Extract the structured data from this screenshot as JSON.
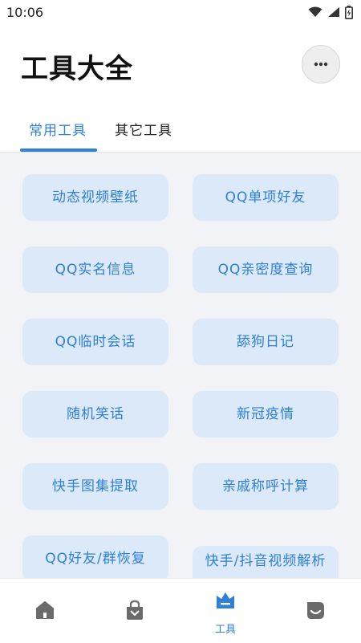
{
  "status_bar": {
    "time": "10:06"
  },
  "header": {
    "title": "工具大全"
  },
  "tabs": [
    {
      "label": "常用工具",
      "active": true
    },
    {
      "label": "其它工具",
      "active": false
    }
  ],
  "tools": [
    "动态视频壁纸",
    "QQ单项好友",
    "QQ实名信息",
    "QQ亲密度查询",
    "QQ临时会话",
    "舔狗日记",
    "随机笑话",
    "新冠疫情",
    "快手图集提取",
    "亲戚称呼计算",
    "QQ好友/群恢复",
    "快手/抖音视频解析"
  ],
  "bottom_nav": [
    {
      "icon": "home-icon",
      "label": ""
    },
    {
      "icon": "shopping-bag-icon",
      "label": ""
    },
    {
      "icon": "tools-icon",
      "label": "工具",
      "active": true
    },
    {
      "icon": "profile-icon",
      "label": ""
    }
  ],
  "colors": {
    "accent": "#2f80d8",
    "button_bg": "#dbe9f8",
    "icon_gray": "#6b6b6b"
  }
}
